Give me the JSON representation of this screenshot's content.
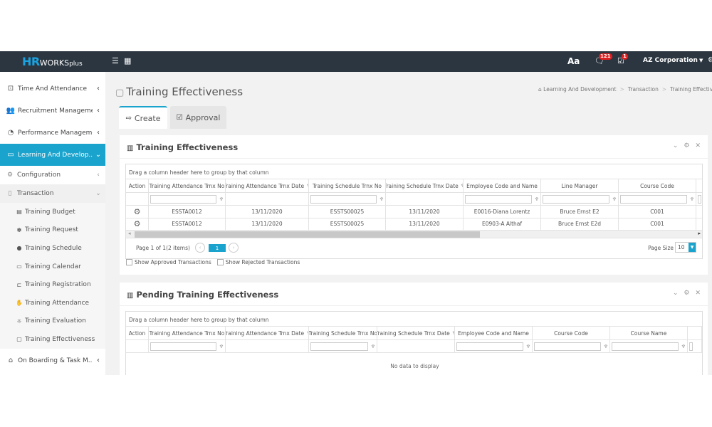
{
  "app": {
    "logo_hr": "HR",
    "logo_works": "WORKS",
    "logo_plus": "plus",
    "font_label": "Aa",
    "notification_count": "121",
    "task_count": "1",
    "company": "AZ Corporation"
  },
  "colors": {
    "accent": "#1aa3cc",
    "topbar": "#2b3640",
    "badge": "#e02020"
  },
  "sidebar": {
    "items": [
      {
        "label": "Time And Attendance",
        "icon": "clock-icon"
      },
      {
        "label": "Recruitment Manageme...",
        "icon": "people-icon"
      },
      {
        "label": "Performance Manageme...",
        "icon": "gauge-icon"
      },
      {
        "label": "Learning And Develop...",
        "icon": "book-icon",
        "active": true
      },
      {
        "label": "On Boarding & Task M...",
        "icon": "onboarding-icon"
      }
    ],
    "sub": [
      {
        "label": "Configuration"
      },
      {
        "label": "Transaction"
      }
    ],
    "leaves": [
      {
        "label": "Training Budget"
      },
      {
        "label": "Training Request"
      },
      {
        "label": "Training Schedule"
      },
      {
        "label": "Training Calendar"
      },
      {
        "label": "Training Registration"
      },
      {
        "label": "Training Attendance"
      },
      {
        "label": "Training Evaluation"
      },
      {
        "label": "Training Effectiveness"
      }
    ]
  },
  "page": {
    "title": "Training Effectiveness",
    "breadcrumb": [
      "Learning And Development",
      "Transaction",
      "Training Effectiveness"
    ],
    "tabs": [
      {
        "label": "Create"
      },
      {
        "label": "Approval"
      }
    ]
  },
  "panel1": {
    "title": "Training Effectiveness",
    "group_hint": "Drag a column header here to group by that column",
    "columns": [
      "Action",
      "Training Attendance Trnx No",
      "Training Attendance Trnx Date",
      "Training Schedule Trnx No",
      "Training Schedule Trnx Date",
      "Employee Code and Name",
      "Line Manager",
      "Course Code"
    ],
    "rows": [
      [
        "ESSTA0012",
        "13/11/2020",
        "ESSTS00025",
        "13/11/2020",
        "E0016-Diana Lorentz",
        "Bruce Ernst E2",
        "C001"
      ],
      [
        "ESSTA0012",
        "13/11/2020",
        "ESSTS00025",
        "13/11/2020",
        "E0903-A Althaf",
        "Bruce Ernst E2d",
        "C001"
      ]
    ],
    "pager_info": "Page 1 of 1(2 items)",
    "current_page": "1",
    "page_size_label": "Page Size",
    "page_size": "10",
    "show_approved": "Show Approved Transactions",
    "show_rejected": "Show Rejected Transactions"
  },
  "panel2": {
    "title": "Pending Training Effectiveness",
    "group_hint": "Drag a column header here to group by that column",
    "columns": [
      "Action",
      "Training Attendance Trnx No",
      "Training Attendance Trnx Date",
      "Training Schedule Trnx No",
      "Training Schedule Trnx Date",
      "Employee Code and Name",
      "Course Code",
      "Course Name"
    ],
    "empty": "No data to display"
  }
}
